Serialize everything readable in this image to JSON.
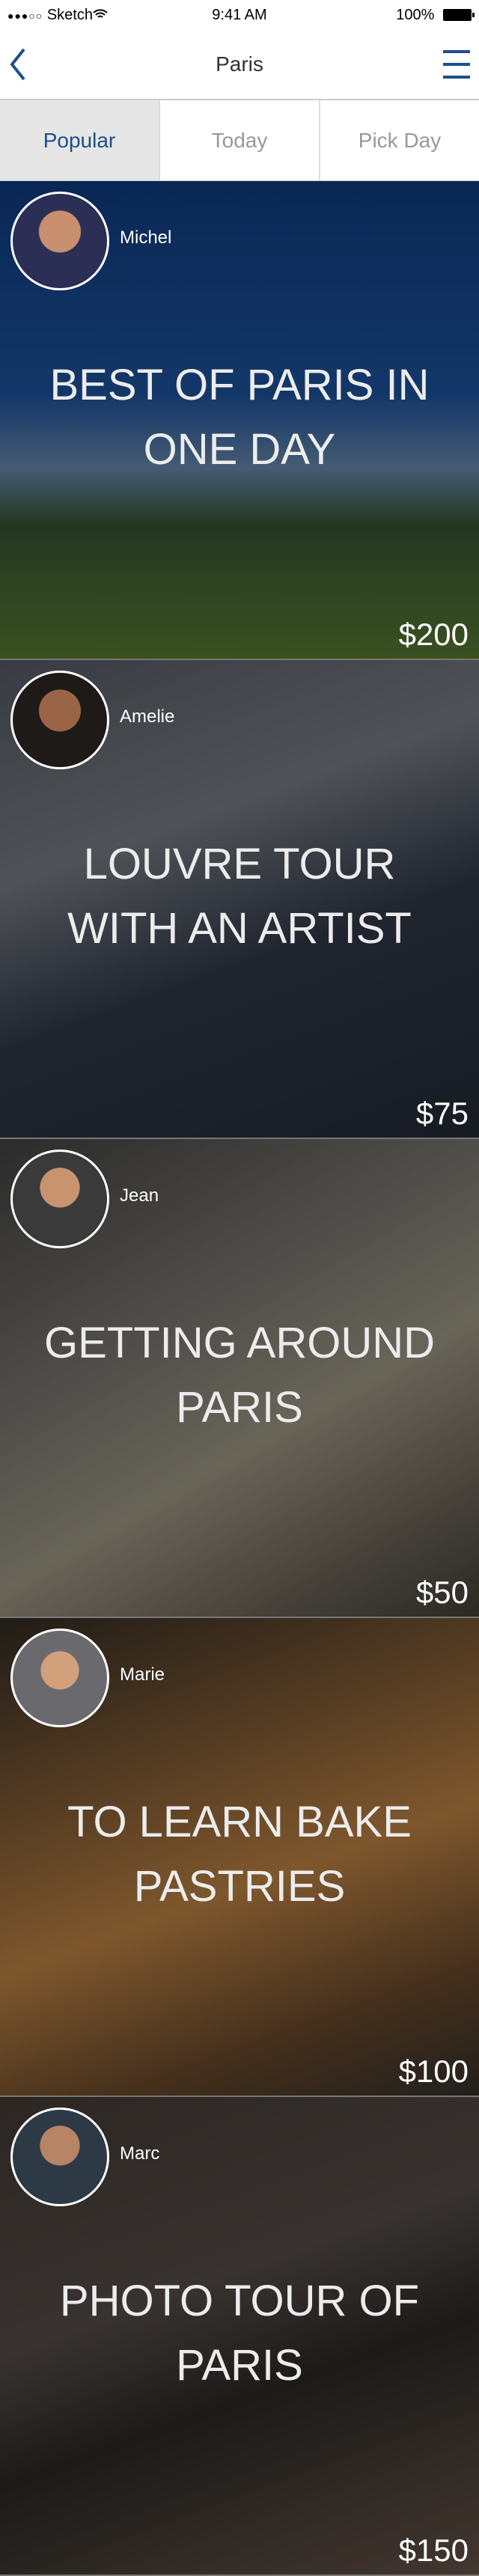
{
  "status": {
    "carrier": "Sketch",
    "signal": "●●●○○",
    "time": "9:41 AM",
    "battery": "100%"
  },
  "nav": {
    "title": "Paris"
  },
  "tabs": [
    {
      "label": "Popular",
      "active": true
    },
    {
      "label": "Today",
      "active": false
    },
    {
      "label": "Pick Day",
      "active": false
    }
  ],
  "tours": [
    {
      "host": "Michel",
      "title": "Best of Paris in one day",
      "price": "$200"
    },
    {
      "host": "Amelie",
      "title": "Louvre tour with an artist",
      "price": "$75"
    },
    {
      "host": "Jean",
      "title": "Getting around Paris",
      "price": "$50"
    },
    {
      "host": "Marie",
      "title": "To learn bake pastries",
      "price": "$100"
    },
    {
      "host": "Marc",
      "title": "Photo tour of Paris",
      "price": "$150"
    }
  ],
  "colors": {
    "accent": "#1d4f8a",
    "active_tab_bg": "#e6e6e6"
  }
}
